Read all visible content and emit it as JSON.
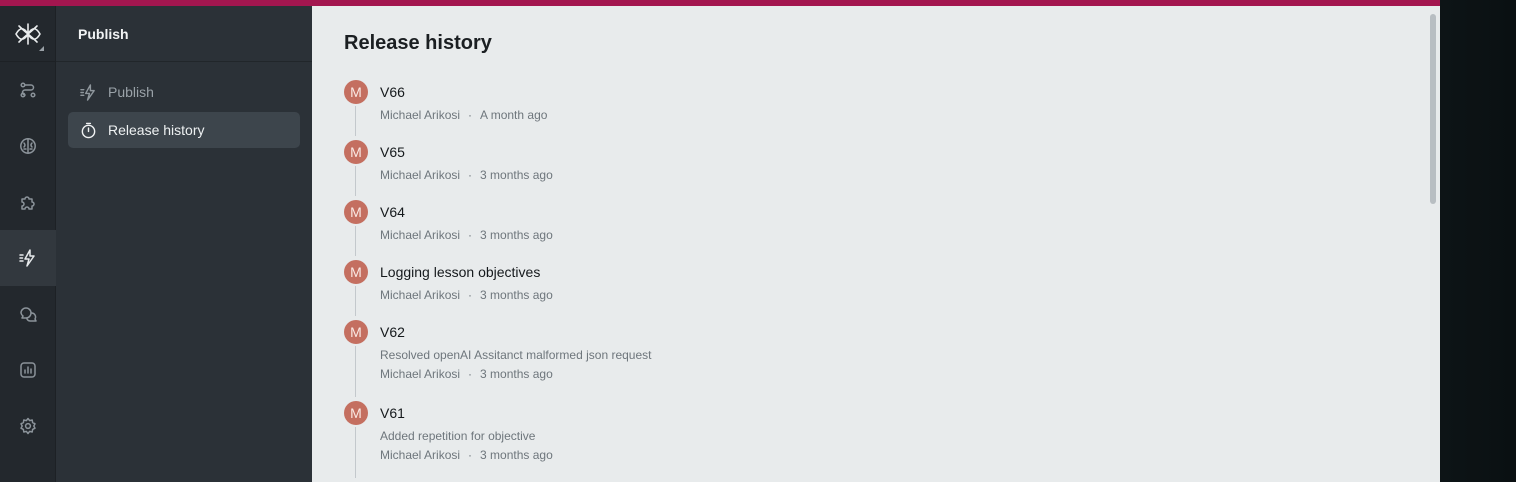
{
  "header": {
    "section_title": "Publish"
  },
  "subnav": {
    "items": [
      {
        "label": "Publish",
        "icon": "publish-bolt-icon",
        "active": false
      },
      {
        "label": "Release history",
        "icon": "stopwatch-icon",
        "active": true
      }
    ]
  },
  "rail": {
    "items": [
      {
        "icon": "logo-icon"
      },
      {
        "icon": "flow-route-icon"
      },
      {
        "icon": "brain-icon"
      },
      {
        "icon": "puzzle-icon"
      },
      {
        "icon": "publish-bolt-icon",
        "active": true
      },
      {
        "icon": "chat-bubbles-icon"
      },
      {
        "icon": "analytics-chart-icon"
      },
      {
        "icon": "gear-icon"
      }
    ]
  },
  "main": {
    "title": "Release history",
    "releases": [
      {
        "avatar": "M",
        "title": "V66",
        "description": "",
        "author": "Michael Arikosi",
        "separator": "·",
        "time": "A month ago"
      },
      {
        "avatar": "M",
        "title": "V65",
        "description": "",
        "author": "Michael Arikosi",
        "separator": "·",
        "time": "3 months ago"
      },
      {
        "avatar": "M",
        "title": "V64",
        "description": "",
        "author": "Michael Arikosi",
        "separator": "·",
        "time": "3 months ago"
      },
      {
        "avatar": "M",
        "title": "Logging lesson objectives",
        "description": "",
        "author": "Michael Arikosi",
        "separator": "·",
        "time": "3 months ago"
      },
      {
        "avatar": "M",
        "title": "V62",
        "description": "Resolved openAI Assitanct malformed json request",
        "author": "Michael Arikosi",
        "separator": "·",
        "time": "3 months ago"
      },
      {
        "avatar": "M",
        "title": "V61",
        "description": "Added repetition for objective",
        "author": "Michael Arikosi",
        "separator": "·",
        "time": "3 months ago"
      }
    ]
  },
  "colors": {
    "accent_bar": "#a3164f",
    "avatar_bg": "#c46f60",
    "rail_bg": "#23282d",
    "subnav_bg": "#2b3137",
    "main_bg": "#e8ebec"
  }
}
